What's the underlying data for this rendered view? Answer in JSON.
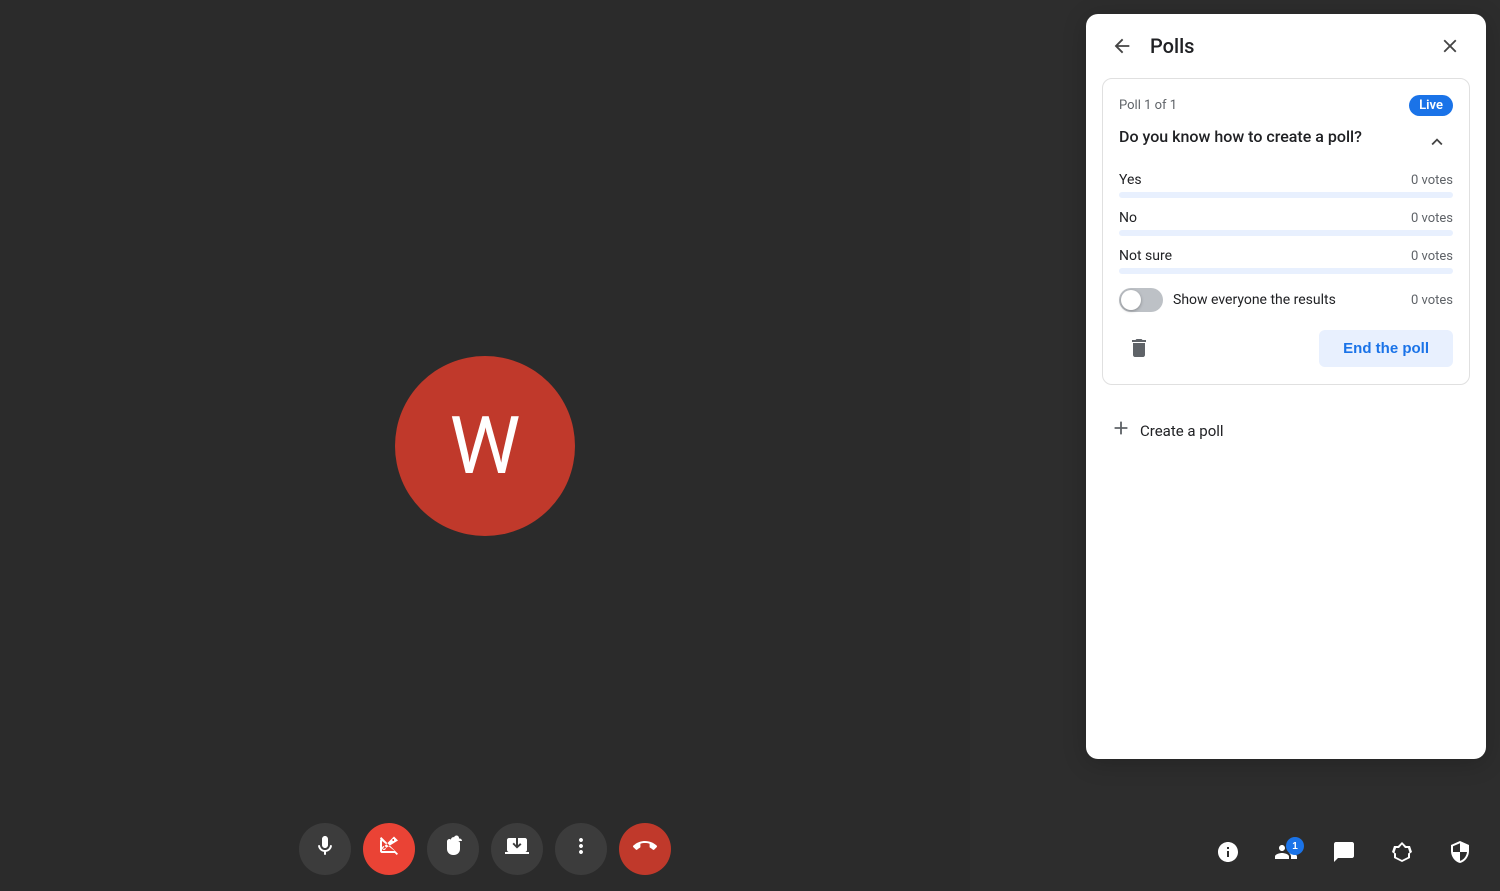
{
  "video_area": {
    "avatar_letter": "W",
    "avatar_bg": "#c0392b"
  },
  "toolbar": {
    "buttons": [
      {
        "id": "mic",
        "icon": "mic",
        "bg": "#3c3c3c",
        "label": "Microphone"
      },
      {
        "id": "camera",
        "icon": "camera-off",
        "bg": "#ea4335",
        "label": "Camera"
      },
      {
        "id": "hand",
        "icon": "hand",
        "bg": "#3c3c3c",
        "label": "Raise hand"
      },
      {
        "id": "share",
        "icon": "share-screen",
        "bg": "#3c3c3c",
        "label": "Share screen"
      },
      {
        "id": "more",
        "icon": "more-vert",
        "bg": "#3c3c3c",
        "label": "More options"
      },
      {
        "id": "end-call",
        "icon": "end-call",
        "bg": "#ea4335",
        "label": "End call"
      }
    ]
  },
  "status_bar": {
    "icons": [
      {
        "id": "info",
        "label": "Meeting info",
        "badge": null
      },
      {
        "id": "people",
        "label": "People",
        "badge": "1"
      },
      {
        "id": "chat",
        "label": "Chat",
        "badge": null
      },
      {
        "id": "activities",
        "label": "Activities",
        "badge": null
      },
      {
        "id": "security",
        "label": "Security",
        "badge": null
      }
    ]
  },
  "polls_panel": {
    "title": "Polls",
    "back_label": "Back",
    "close_label": "Close",
    "poll": {
      "counter": "Poll 1 of 1",
      "live_badge": "Live",
      "question": "Do you know how to create a poll?",
      "options": [
        {
          "label": "Yes",
          "votes": "0 votes",
          "fill_pct": 0
        },
        {
          "label": "No",
          "votes": "0 votes",
          "fill_pct": 0
        },
        {
          "label": "Not sure",
          "votes": "0 votes",
          "fill_pct": 0
        }
      ],
      "show_results_label": "Show everyone the results",
      "show_results_votes": "0 votes",
      "show_results_enabled": false,
      "delete_label": "Delete poll",
      "end_poll_label": "End the poll"
    },
    "create_poll_label": "Create a poll"
  }
}
